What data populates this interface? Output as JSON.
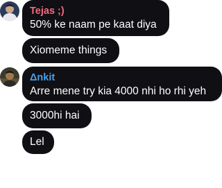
{
  "messages": [
    {
      "sender": "Tejas ;)",
      "sender_color": "#f06b7e",
      "text": "50% ke naam pe kaat diya",
      "avatar": "user-avatar-photo"
    },
    {
      "text": "Xiomeme things"
    },
    {
      "sender": "Δnkit",
      "sender_color": "#4a9fe8",
      "text": "Arre mene try kia 4000 nhi ho rhi yeh",
      "avatar": "user-avatar-photo"
    },
    {
      "text": "3000hi hai"
    },
    {
      "text": "Lel"
    }
  ],
  "colors": {
    "bubble": "#0f0f14",
    "background": "#ffffff",
    "text": "#ffffff"
  }
}
